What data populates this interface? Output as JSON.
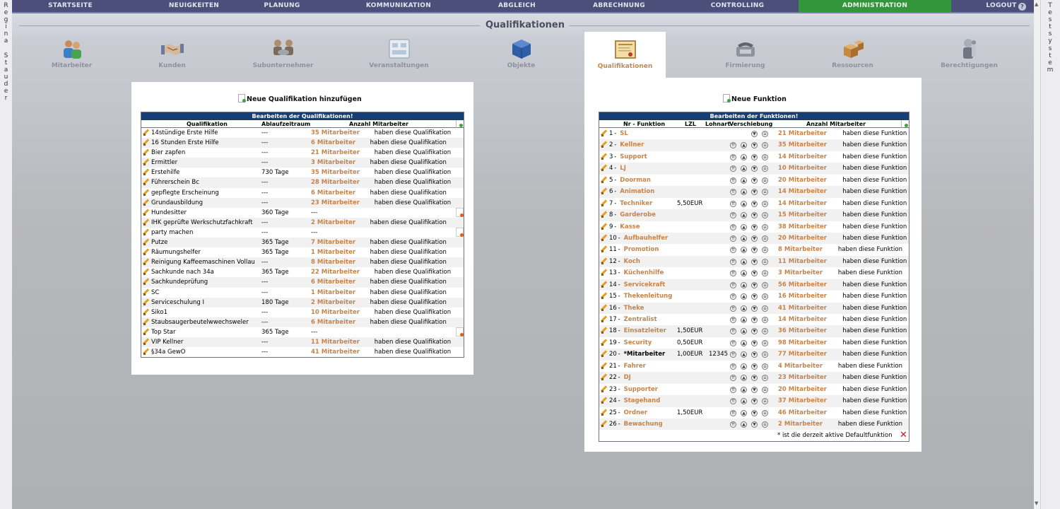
{
  "left_user_letters": [
    "R",
    "e",
    "g",
    "i",
    "n",
    "a",
    " ",
    "S",
    "t",
    "a",
    "u",
    "d",
    "e",
    "r"
  ],
  "right_system_letters": [
    "T",
    "e",
    "s",
    "t",
    "s",
    "y",
    "s",
    "t",
    "e",
    "m"
  ],
  "nav": [
    "STARTSEITE",
    "NEUIGKEITEN",
    "PLANUNG",
    "KOMMUNIKATION",
    "ABGLEICH",
    "ABRECHNUNG",
    "CONTROLLING",
    "ADMINISTRATION",
    "LOGOUT"
  ],
  "nav_active": "ADMINISTRATION",
  "page_title": "Qualifikationen",
  "tabs": [
    "Mitarbeiter",
    "Kunden",
    "Subunternehmer",
    "Veranstaltungen",
    "Objekte",
    "Qualifikationen",
    "Firmierung",
    "Ressourcen",
    "Berechtigungen"
  ],
  "tab_active": "Qualifikationen",
  "qual": {
    "add_label": "Neue Qualifikation hinzufügen",
    "caption": "Bearbeiten der Qualifikationen!",
    "col_name": "Qualifikation",
    "col_expiry": "Ablaufzeitraum",
    "col_count": "Anzahl Mitarbeiter",
    "rows": [
      {
        "name": "14stündige Erste Hilfe",
        "expiry": "---",
        "count": "35 Mitarbeiter",
        "suffix": "haben diese Qualifikation"
      },
      {
        "name": "16 Stunden Erste Hilfe",
        "expiry": "---",
        "count": "6 Mitarbeiter",
        "suffix": "haben diese Qualifikation"
      },
      {
        "name": "Bier zapfen",
        "expiry": "---",
        "count": "21 Mitarbeiter",
        "suffix": "haben diese Qualifikation"
      },
      {
        "name": "Ermittler",
        "expiry": "---",
        "count": "3 Mitarbeiter",
        "suffix": "haben diese Qualifikation"
      },
      {
        "name": "Erstehilfe",
        "expiry": "730 Tage",
        "count": "35 Mitarbeiter",
        "suffix": "haben diese Qualifikation"
      },
      {
        "name": "Führerschein Bc",
        "expiry": "---",
        "count": "28 Mitarbeiter",
        "suffix": "haben diese Qualifikation"
      },
      {
        "name": "gepflegte Erscheinung",
        "expiry": "---",
        "count": "6 Mitarbeiter",
        "suffix": "haben diese Qualifikation"
      },
      {
        "name": "Grundausbildung",
        "expiry": "---",
        "count": "23 Mitarbeiter",
        "suffix": "haben diese Qualifikation"
      },
      {
        "name": "Hundesitter",
        "expiry": "360 Tage",
        "count": "---",
        "suffix": "",
        "deletable": true
      },
      {
        "name": "IHK geprüfte Werkschutzfachkraft",
        "expiry": "---",
        "count": "2 Mitarbeiter",
        "suffix": "haben diese Qualifikation"
      },
      {
        "name": "party machen",
        "expiry": "---",
        "count": "---",
        "suffix": "",
        "deletable": true
      },
      {
        "name": "Putze",
        "expiry": "365 Tage",
        "count": "7 Mitarbeiter",
        "suffix": "haben diese Qualifikation"
      },
      {
        "name": "Räumungshelfer",
        "expiry": "365 Tage",
        "count": "1 Mitarbeiter",
        "suffix": "haben diese Qualifikation"
      },
      {
        "name": "Reinigung Kaffeemaschinen Vollau",
        "expiry": "---",
        "count": "8 Mitarbeiter",
        "suffix": "haben diese Qualifikation"
      },
      {
        "name": "Sachkunde nach 34a",
        "expiry": "365 Tage",
        "count": "22 Mitarbeiter",
        "suffix": "haben diese Qualifikation"
      },
      {
        "name": "Sachkundeprüfung",
        "expiry": "---",
        "count": "6 Mitarbeiter",
        "suffix": "haben diese Qualifikation"
      },
      {
        "name": "SC",
        "expiry": "---",
        "count": "1 Mitarbeiter",
        "suffix": "haben diese Qualifikation"
      },
      {
        "name": "Serviceschulung I",
        "expiry": "180 Tage",
        "count": "2 Mitarbeiter",
        "suffix": "haben diese Qualifikation"
      },
      {
        "name": "Siko1",
        "expiry": "---",
        "count": "10 Mitarbeiter",
        "suffix": "haben diese Qualifikation"
      },
      {
        "name": "Staubsaugerbeutelwwechsweler",
        "expiry": "---",
        "count": "6 Mitarbeiter",
        "suffix": "haben diese Qualifikation"
      },
      {
        "name": "Top Star",
        "expiry": "365 Tage",
        "count": "---",
        "suffix": "",
        "deletable": true
      },
      {
        "name": "VIP Kellner",
        "expiry": "---",
        "count": "11 Mitarbeiter",
        "suffix": "haben diese Qualifikation"
      },
      {
        "name": "§34a GewO",
        "expiry": "---",
        "count": "41 Mitarbeiter",
        "suffix": "haben diese Qualifikation"
      }
    ]
  },
  "func": {
    "add_label": "Neue Funktion",
    "caption": "Bearbeiten der Funktionen!",
    "col_name": "Nr - Funktion",
    "col_lzl": "LZL",
    "col_lohnart": "Lohnart",
    "col_move": "Verschiebung",
    "col_count": "Anzahl Mitarbeiter",
    "suffix": "haben diese Funktion",
    "footnote": "* ist die derzeit aktive Defaultfunktion",
    "rows": [
      {
        "nr": "1",
        "name": "SL",
        "lzl": "",
        "lohnart": "",
        "count": "21 Mitarbeiter",
        "first": true
      },
      {
        "nr": "2",
        "name": "Kellner",
        "lzl": "",
        "lohnart": "",
        "count": "35 Mitarbeiter"
      },
      {
        "nr": "3",
        "name": "Support",
        "lzl": "",
        "lohnart": "",
        "count": "14 Mitarbeiter"
      },
      {
        "nr": "4",
        "name": "LJ",
        "lzl": "",
        "lohnart": "",
        "count": "10 Mitarbeiter"
      },
      {
        "nr": "5",
        "name": "Doorman",
        "lzl": "",
        "lohnart": "",
        "count": "20 Mitarbeiter"
      },
      {
        "nr": "6",
        "name": "Animation",
        "lzl": "",
        "lohnart": "",
        "count": "14 Mitarbeiter"
      },
      {
        "nr": "7",
        "name": "Techniker",
        "lzl": "5,50EUR",
        "lohnart": "",
        "count": "14 Mitarbeiter"
      },
      {
        "nr": "8",
        "name": "Garderobe",
        "lzl": "",
        "lohnart": "",
        "count": "15 Mitarbeiter"
      },
      {
        "nr": "9",
        "name": "Kasse",
        "lzl": "",
        "lohnart": "",
        "count": "38 Mitarbeiter"
      },
      {
        "nr": "10",
        "name": "Aufbauhelfer",
        "lzl": "",
        "lohnart": "",
        "count": "20 Mitarbeiter"
      },
      {
        "nr": "11",
        "name": "Promotion",
        "lzl": "",
        "lohnart": "",
        "count": "8 Mitarbeiter"
      },
      {
        "nr": "12",
        "name": "Koch",
        "lzl": "",
        "lohnart": "",
        "count": "11 Mitarbeiter"
      },
      {
        "nr": "13",
        "name": "Küchenhilfe",
        "lzl": "",
        "lohnart": "",
        "count": "3 Mitarbeiter"
      },
      {
        "nr": "14",
        "name": "Servicekraft",
        "lzl": "",
        "lohnart": "",
        "count": "56 Mitarbeiter"
      },
      {
        "nr": "15",
        "name": "Thekenleitung",
        "lzl": "",
        "lohnart": "",
        "count": "16 Mitarbeiter"
      },
      {
        "nr": "16",
        "name": "Theke",
        "lzl": "",
        "lohnart": "",
        "count": "41 Mitarbeiter"
      },
      {
        "nr": "17",
        "name": "Zentralist",
        "lzl": "",
        "lohnart": "",
        "count": "14 Mitarbeiter"
      },
      {
        "nr": "18",
        "name": "Einsatzleiter",
        "lzl": "1,50EUR",
        "lohnart": "",
        "count": "36 Mitarbeiter"
      },
      {
        "nr": "19",
        "name": "Security",
        "lzl": "0,50EUR",
        "lohnart": "",
        "count": "98 Mitarbeiter"
      },
      {
        "nr": "20",
        "name": "*Mitarbeiter",
        "lzl": "1,00EUR",
        "lohnart": "12345",
        "count": "77 Mitarbeiter",
        "default": true
      },
      {
        "nr": "21",
        "name": "Fahrer",
        "lzl": "",
        "lohnart": "",
        "count": "4 Mitarbeiter"
      },
      {
        "nr": "22",
        "name": "DJ",
        "lzl": "",
        "lohnart": "",
        "count": "23 Mitarbeiter"
      },
      {
        "nr": "23",
        "name": "Supporter",
        "lzl": "",
        "lohnart": "",
        "count": "20 Mitarbeiter"
      },
      {
        "nr": "24",
        "name": "Stagehand",
        "lzl": "",
        "lohnart": "",
        "count": "37 Mitarbeiter"
      },
      {
        "nr": "25",
        "name": "Ordner",
        "lzl": "1,50EUR",
        "lohnart": "",
        "count": "46 Mitarbeiter"
      },
      {
        "nr": "26",
        "name": "Bewachung",
        "lzl": "",
        "lohnart": "",
        "count": "2 Mitarbeiter"
      }
    ]
  }
}
